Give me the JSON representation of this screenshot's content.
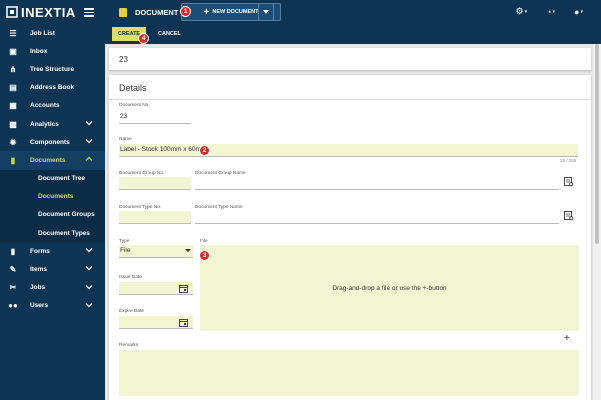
{
  "app": {
    "logo_text": "INEXTIA"
  },
  "sidebar": {
    "items": [
      {
        "label": "Job List",
        "icon": "list-icon"
      },
      {
        "label": "Inbox",
        "icon": "inbox-icon"
      },
      {
        "label": "Tree Structure",
        "icon": "tree-icon"
      },
      {
        "label": "Address Book",
        "icon": "address-book-icon"
      },
      {
        "label": "Accounts",
        "icon": "accounts-icon"
      },
      {
        "label": "Analytics",
        "icon": "analytics-icon"
      },
      {
        "label": "Components",
        "icon": "components-icon"
      },
      {
        "label": "Documents",
        "icon": "document-icon"
      },
      {
        "label": "Forms",
        "icon": "forms-icon"
      },
      {
        "label": "Items",
        "icon": "items-icon"
      },
      {
        "label": "Jobs",
        "icon": "wrench-icon"
      },
      {
        "label": "Users",
        "icon": "users-icon"
      }
    ],
    "sub_items": [
      {
        "label": "Document Tree"
      },
      {
        "label": "Documents"
      },
      {
        "label": "Document Groups"
      },
      {
        "label": "Document Types"
      }
    ]
  },
  "topbar": {
    "title": "DOCUMENT",
    "new_button": "NEW DOCUMENT"
  },
  "actions": {
    "create": "CREATE",
    "cancel": "CANCEL"
  },
  "markers": [
    "1",
    "2",
    "3",
    "4"
  ],
  "header_number": "23",
  "details": {
    "title": "Details",
    "document_no_label": "Document No.",
    "document_no_value": "23",
    "name_label": "Name",
    "name_value": "Label - Stock 100mm x 60mm",
    "name_counter": "26 / 255",
    "group_no_label": "Document Group No.",
    "group_name_label": "Document Group Name",
    "type_no_label": "Document Type No.",
    "type_name_label": "Document Type Name",
    "type_label": "Type",
    "type_value": "File",
    "file_label": "File",
    "dropzone_text": "Drag-and-drop a file or use the +-button",
    "issue_date_label": "Issue Date",
    "expire_date_label": "Expire Date",
    "remarks_label": "Remarks"
  },
  "colors": {
    "navy": "#0d3553",
    "accent": "#c8e03c",
    "field_bg": "#f2f5d2",
    "marker": "#d92b2b"
  }
}
